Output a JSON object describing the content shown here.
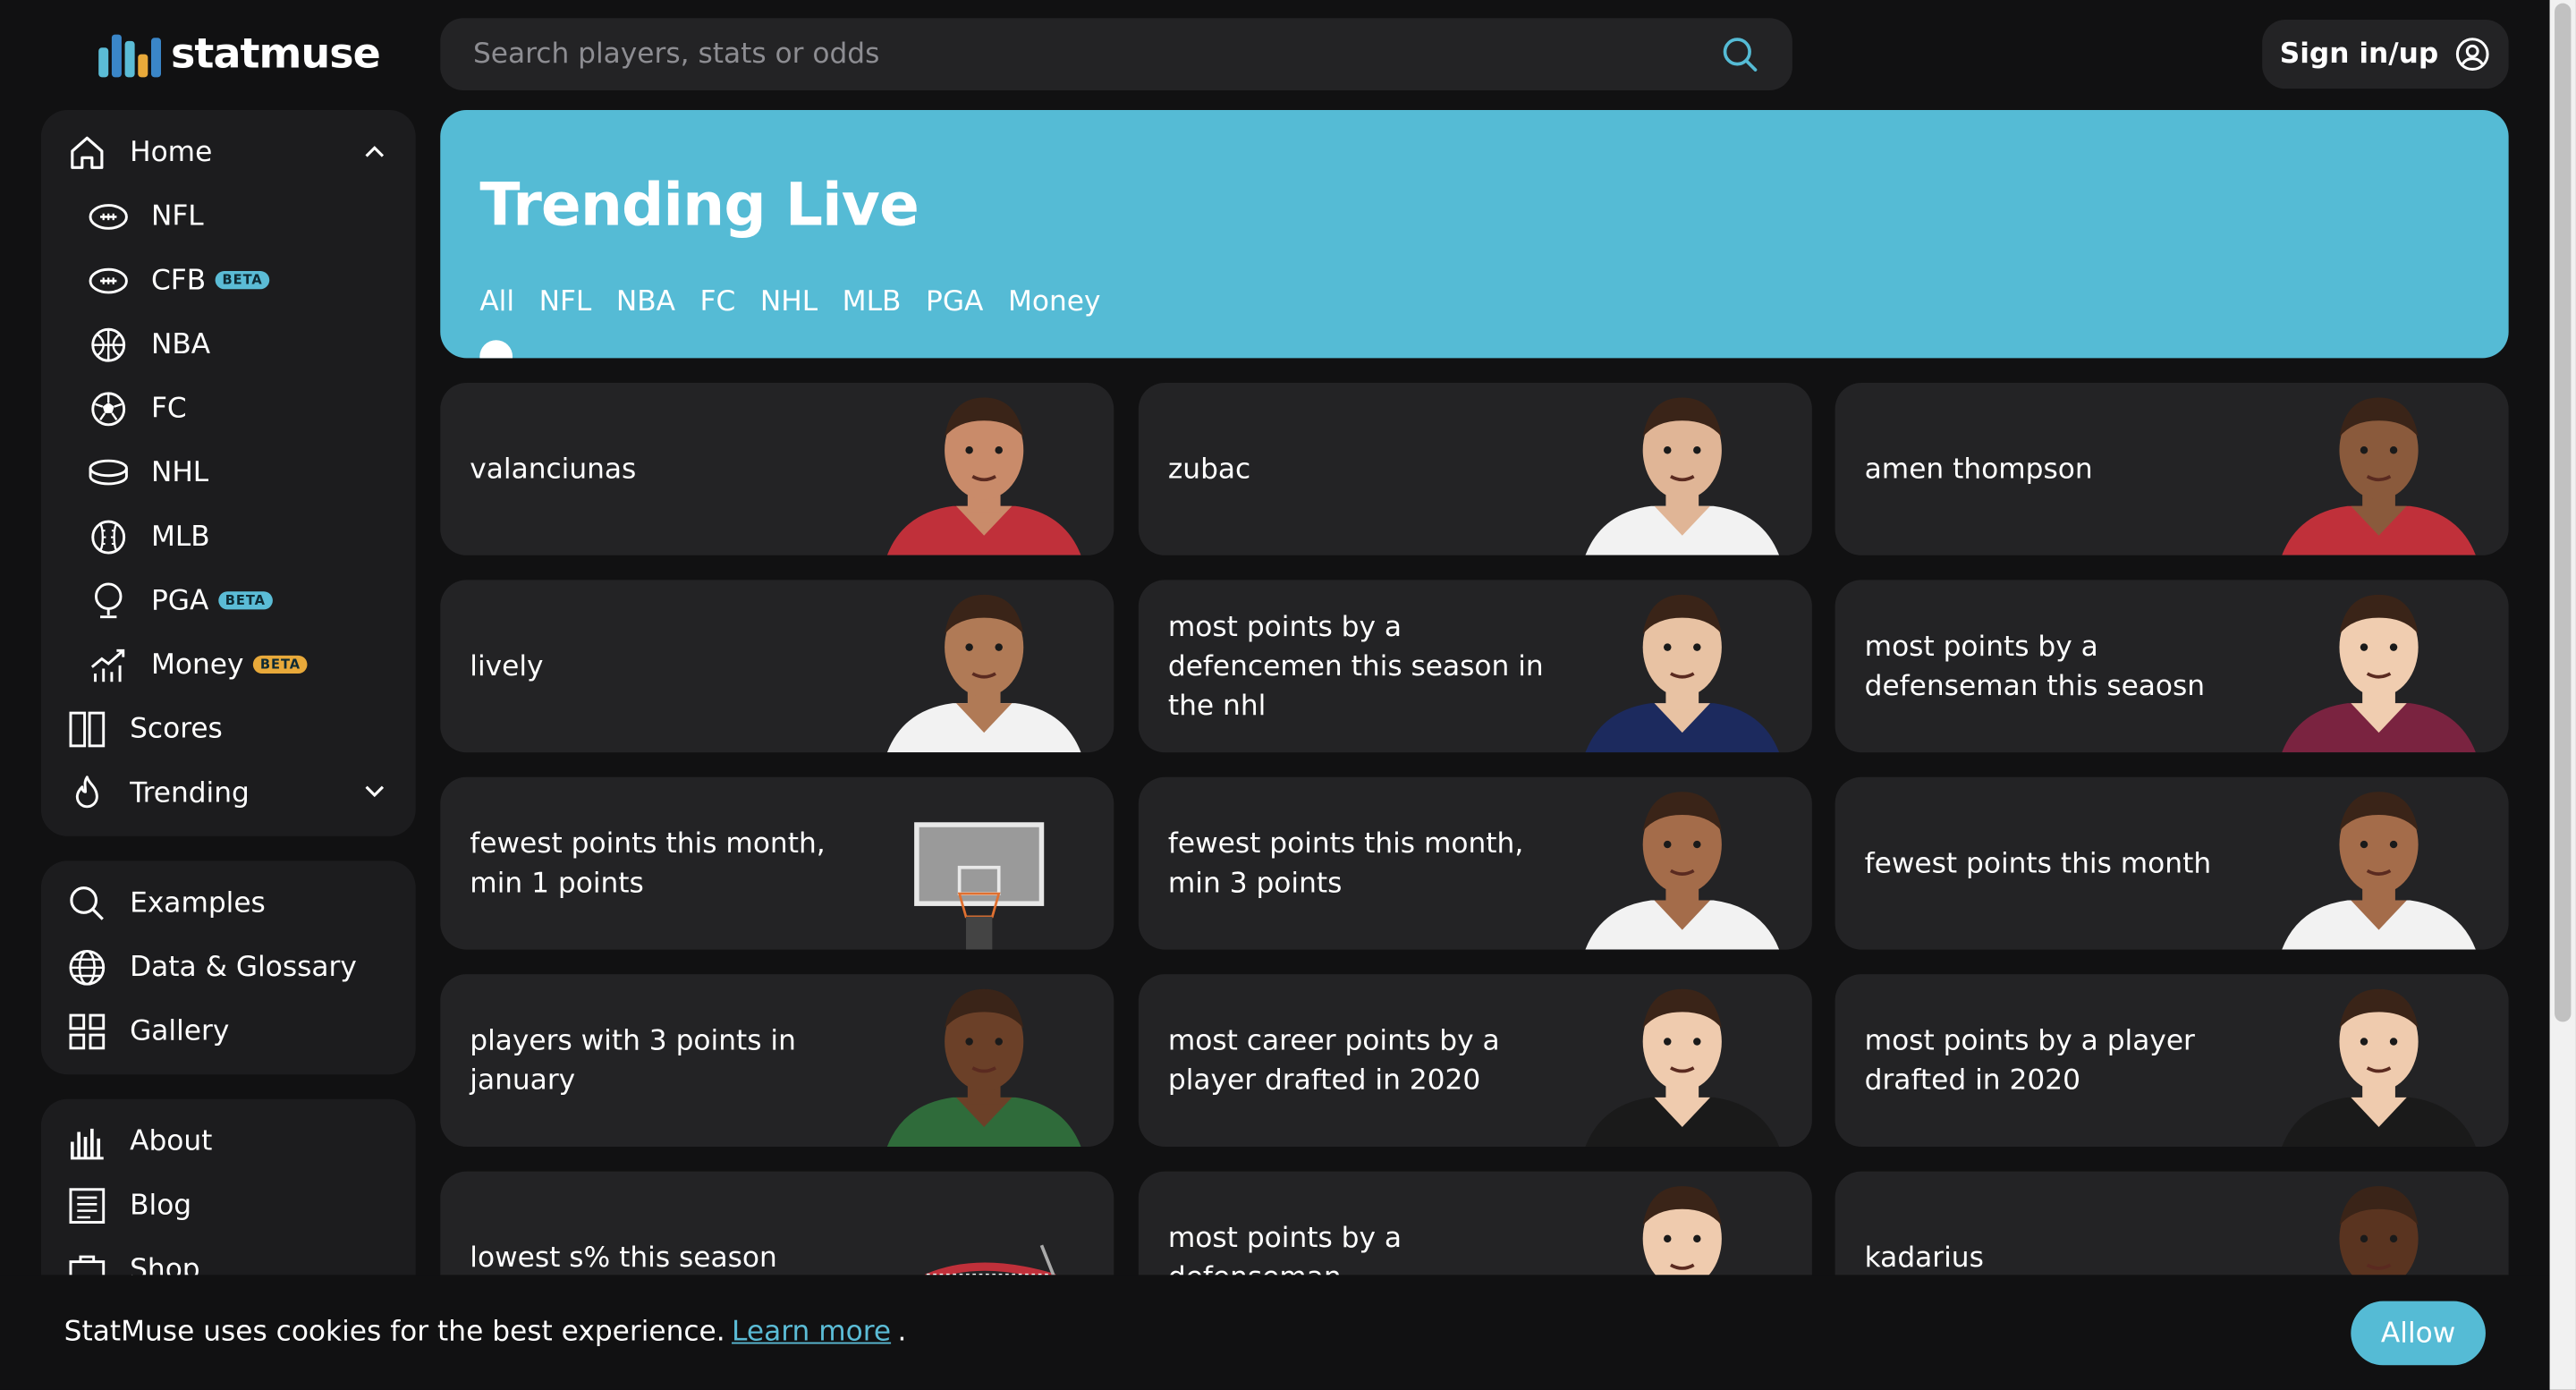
{
  "brand": {
    "name": "statmuse",
    "accent": "#55bbd5"
  },
  "search": {
    "placeholder": "Search players, stats or odds"
  },
  "account": {
    "signin_label": "Sign in/up"
  },
  "sidebar": {
    "home": "Home",
    "leagues": [
      {
        "label": "NFL",
        "badge": "",
        "icon": "football-icon"
      },
      {
        "label": "CFB",
        "badge": "BETA",
        "icon": "football-icon"
      },
      {
        "label": "NBA",
        "badge": "",
        "icon": "basketball-icon"
      },
      {
        "label": "FC",
        "badge": "",
        "icon": "soccer-ball-icon"
      },
      {
        "label": "NHL",
        "badge": "",
        "icon": "hockey-puck-icon"
      },
      {
        "label": "MLB",
        "badge": "",
        "icon": "baseball-icon"
      },
      {
        "label": "PGA",
        "badge": "BETA",
        "icon": "golf-icon"
      },
      {
        "label": "Money",
        "badge": "BETA",
        "icon": "chart-icon"
      }
    ],
    "scores": "Scores",
    "trending": "Trending",
    "examples": "Examples",
    "glossary": "Data & Glossary",
    "gallery": "Gallery",
    "about": "About",
    "blog": "Blog",
    "shop": "Shop"
  },
  "hero": {
    "title": "Trending Live",
    "tabs": [
      "All",
      "NFL",
      "NBA",
      "FC",
      "NHL",
      "MLB",
      "PGA",
      "Money"
    ],
    "active_tab": "All"
  },
  "cards": [
    {
      "text": "valanciunas",
      "avatar": "player-avatar"
    },
    {
      "text": "zubac",
      "avatar": "player-avatar"
    },
    {
      "text": "amen thompson",
      "avatar": "player-avatar"
    },
    {
      "text": "lively",
      "avatar": "player-avatar"
    },
    {
      "text": "most points by a defencemen this season in the nhl",
      "avatar": "hockey-player-avatar"
    },
    {
      "text": "most points by a defenseman this seaosn",
      "avatar": "hockey-player-avatar"
    },
    {
      "text": "fewest points this month, min 1 points",
      "avatar": "basketball-hoop-icon"
    },
    {
      "text": "fewest points this month, min 3 points",
      "avatar": "player-avatar"
    },
    {
      "text": "fewest points this month",
      "avatar": "player-avatar"
    },
    {
      "text": "players with 3 points in january",
      "avatar": "player-avatar"
    },
    {
      "text": "most career points by a player drafted in 2020",
      "avatar": "hockey-player-avatar"
    },
    {
      "text": "most points by a player drafted in 2020",
      "avatar": "hockey-player-avatar"
    },
    {
      "text": "lowest s% this season",
      "avatar": "hockey-net-icon"
    },
    {
      "text": "most points by a defenseman",
      "avatar": "hockey-player-avatar"
    },
    {
      "text": "kadarius",
      "avatar": "player-avatar"
    }
  ],
  "cookie": {
    "message": "StatMuse uses cookies for the best experience.",
    "link": "Learn more",
    "period": ".",
    "allow_label": "Allow"
  }
}
